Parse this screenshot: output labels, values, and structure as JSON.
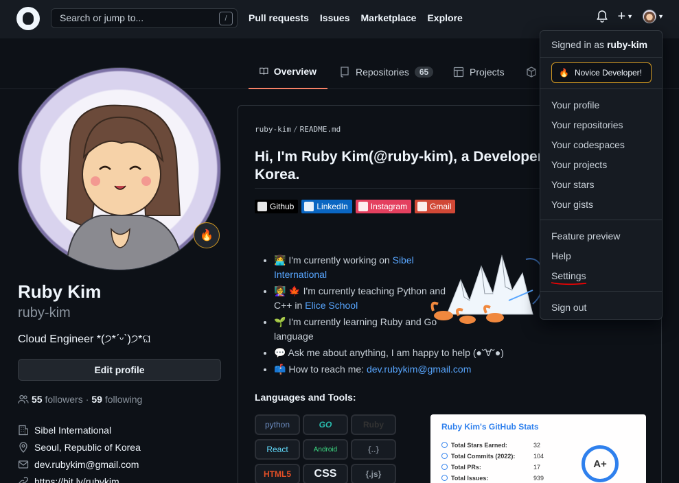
{
  "header": {
    "search_placeholder": "Search or jump to...",
    "slash_key": "/",
    "nav": [
      "Pull requests",
      "Issues",
      "Marketplace",
      "Explore"
    ],
    "plus": "+"
  },
  "tabs": [
    {
      "label": "Overview",
      "icon": "book-icon",
      "active": true
    },
    {
      "label": "Repositories",
      "icon": "repo-icon",
      "count": "65"
    },
    {
      "label": "Projects",
      "icon": "table-icon"
    },
    {
      "label": "",
      "icon": "package-icon"
    }
  ],
  "profile": {
    "full_name": "Ruby Kim",
    "username": "ruby-kim",
    "bio": "Cloud Engineer *(੭*ˊᵕˋ)੭*ଘ",
    "edit_button": "Edit profile",
    "followers_count": "55",
    "followers_label": "followers",
    "following_count": "59",
    "following_label": "following",
    "dot": "·",
    "organization": "Sibel International",
    "location": "Seoul, Republic of Korea",
    "email": "dev.rubykim@gmail.com",
    "website": "https://bit.ly/rubykim",
    "status_emoji": "🔥"
  },
  "readme": {
    "path_user": "ruby-kim",
    "path_sep": "/",
    "path_file": "README.md",
    "title": "Hi, I'm Ruby Kim(@ruby-kim), a Developer Korea.",
    "badges": [
      {
        "label": "Github",
        "color": "#000000"
      },
      {
        "label": "LinkedIn",
        "color": "#0a66c2"
      },
      {
        "label": "Instagram",
        "color": "#e4405f"
      },
      {
        "label": "Gmail",
        "color": "#d14836"
      }
    ],
    "bullets": [
      {
        "emoji": "👩‍💻",
        "text": " I'm currently working on ",
        "link": "Sibel International"
      },
      {
        "emoji": "👩‍🏫 🍁",
        "text": " I'm currently teaching Python and C++ in ",
        "link": "Elice School"
      },
      {
        "emoji": "🌱",
        "text": " I'm currently learning Ruby and Go language",
        "link": ""
      },
      {
        "emoji": "💬",
        "text": " Ask me about anything, I am happy to help (●˘∀˘●)",
        "link": ""
      },
      {
        "emoji": "📫",
        "text": " How to reach me: ",
        "link": "dev.rubykim@gmail.com"
      }
    ],
    "languages_title": "Languages and Tools:",
    "lang_tiles": [
      "python",
      "GO",
      "Ruby",
      "React",
      "Android",
      "{..}",
      "HTML5",
      "CSS",
      "{.js}"
    ],
    "stats": {
      "title": "Ruby Kim's GitHub Stats",
      "rows": [
        {
          "label": "Total Stars Earned:",
          "value": "32"
        },
        {
          "label": "Total Commits (2022):",
          "value": "104"
        },
        {
          "label": "Total PRs:",
          "value": "17"
        },
        {
          "label": "Total Issues:",
          "value": "939"
        }
      ],
      "grade": "A+"
    }
  },
  "dropdown": {
    "signed_prefix": "Signed in as",
    "signed_user": "ruby-kim",
    "status": "Novice Developer!",
    "status_emoji": "🔥",
    "group1": [
      "Your profile",
      "Your repositories",
      "Your codespaces",
      "Your projects",
      "Your stars",
      "Your gists"
    ],
    "group2": [
      "Feature preview",
      "Help",
      "Settings"
    ],
    "sign_out": "Sign out"
  },
  "colors": {
    "accent_link": "#58a6ff",
    "tab_underline": "#f78166",
    "status_border": "#d29922",
    "annotation_red": "#ff0000"
  }
}
